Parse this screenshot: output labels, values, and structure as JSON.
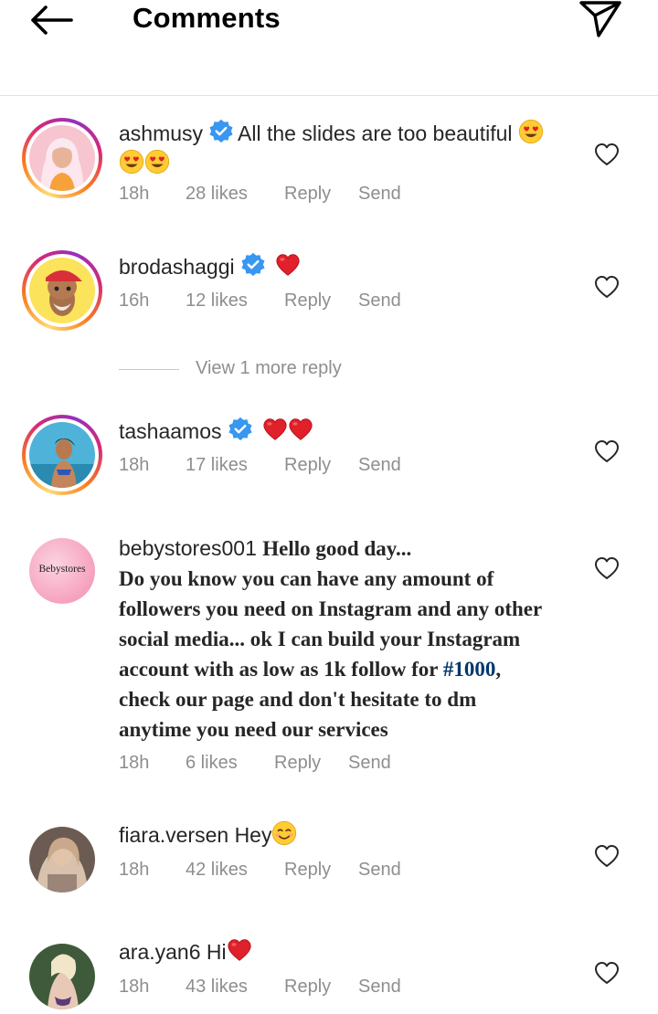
{
  "header": {
    "title": "Comments"
  },
  "comments": [
    {
      "username": "ashmusy",
      "verified": true,
      "text": "All the slides are too beautiful",
      "time": "18h",
      "likes": "28 likes",
      "reply": "Reply",
      "send": "Send"
    },
    {
      "username": "brodashaggi",
      "verified": true,
      "text": "",
      "time": "16h",
      "likes": "12 likes",
      "reply": "Reply",
      "send": "Send"
    },
    {
      "username": "tashaamos",
      "verified": true,
      "text": "",
      "time": "18h",
      "likes": "17 likes",
      "reply": "Reply",
      "send": "Send"
    },
    {
      "username": "bebystores001",
      "verified": false,
      "avatar_label": "Bebystores",
      "lines": [
        "Hello good day...",
        "Do you know you can have any amount of",
        "followers you need on Instagram and any other",
        "social media... ok I can build your Instagram",
        "account with as low as 1k follow for ",
        "check our page and don't hesitate to dm",
        "anytime you need our services"
      ],
      "hashtag": "#1000",
      "hashtag_suffix": ",",
      "time": "18h",
      "likes": "6 likes",
      "reply": "Reply",
      "send": "Send"
    },
    {
      "username": "fiara.versen",
      "verified": false,
      "text": "Hey",
      "time": "18h",
      "likes": "42 likes",
      "reply": "Reply",
      "send": "Send"
    },
    {
      "username": "ara.yan6",
      "verified": false,
      "text": "Hi",
      "time": "18h",
      "likes": "43 likes",
      "reply": "Reply",
      "send": "Send"
    }
  ],
  "view_more_replies": "View 1 more reply",
  "colors": {
    "verified": "#3897f0",
    "heart": "#ed4956",
    "meta": "#8e8e8e",
    "hashtag": "#00376b"
  },
  "icons": [
    "back-arrow-icon",
    "send-icon",
    "verified-badge-icon",
    "heart-outline-icon",
    "red-heart-emoji",
    "heart-eyes-emoji",
    "smiling-emoji"
  ]
}
